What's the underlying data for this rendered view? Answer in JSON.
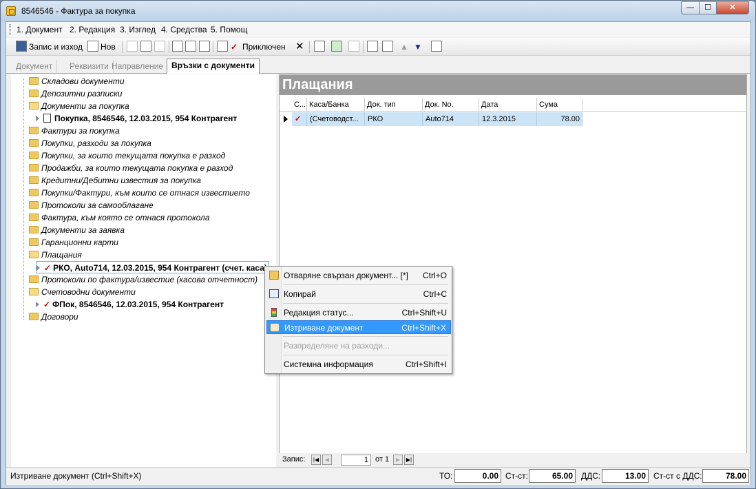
{
  "window": {
    "title": "8546546 - Фактура за покупка",
    "close_label": "✕",
    "min_label": "—",
    "max_label": "☐"
  },
  "menu": [
    "1. Документ",
    "2. Редакция",
    "3. Изглед",
    "4. Средства",
    "5. Помощ"
  ],
  "toolbar": {
    "save_exit": "Запис и изход",
    "new": "Нов",
    "posted": "Приключен"
  },
  "tabs": [
    "Документ",
    "Реквизити",
    "Направление",
    "Връзки с документи"
  ],
  "tree": [
    {
      "label": "Складови документи"
    },
    {
      "label": "Депозитни разписки"
    },
    {
      "label": "Документи за покупка"
    },
    {
      "label": "Покупка, 8546546, 12.03.2015, 954 Контрагент"
    },
    {
      "label": "Фактури за покупка"
    },
    {
      "label": "Покупки, разходи за покупка"
    },
    {
      "label": "Покупки, за които текущата покупка е разход"
    },
    {
      "label": "Продажби, за които текущата покупка е разход"
    },
    {
      "label": "Кредитни/Дебитни известия за покупка"
    },
    {
      "label": "Покупки/Фактури, към които се отнася известието"
    },
    {
      "label": "Протоколи за самооблагане"
    },
    {
      "label": "Фактура, към която се отнася протокола"
    },
    {
      "label": "Документи за заявка"
    },
    {
      "label": "Гаранционни карти"
    },
    {
      "label": "Плащания"
    },
    {
      "label": "РКО, Auto714, 12.03.2015, 954 Контрагент (счет. каса)"
    },
    {
      "label": "Протоколи по фактура/известие (касова отчетност)"
    },
    {
      "label": "Счетоводни документи"
    },
    {
      "label": "ФПок, 8546546, 12.03.2015, 954 Контрагент"
    },
    {
      "label": "Договори"
    }
  ],
  "pane": {
    "title": "Плащания"
  },
  "grid": {
    "columns": [
      "С...",
      "Каса/Банка",
      "Док. тип",
      "Док. No.",
      "Дата",
      "Сума"
    ],
    "rows": [
      {
        "status": "✓",
        "cash": "(Счетоводст...",
        "type": "РКО",
        "no": "Auto714",
        "date": "12.3.2015",
        "sum": "78.00"
      }
    ]
  },
  "pager": {
    "label": "Запис:",
    "value": "1",
    "of": "от 1"
  },
  "context_menu": [
    {
      "label": "Отваряне свързан документ... [*]",
      "shortcut": "Ctrl+O"
    },
    {
      "label": "Копирай",
      "shortcut": "Ctrl+C"
    },
    {
      "label": "Редакция статус...",
      "shortcut": "Ctrl+Shift+U"
    },
    {
      "label": "Изтриване документ",
      "shortcut": "Ctrl+Shift+X"
    },
    {
      "label": "Разпределяне на разходи...",
      "shortcut": ""
    },
    {
      "label": "Системна информация",
      "shortcut": "Ctrl+Shift+I"
    }
  ],
  "status": {
    "text": "Изтриване документ (Ctrl+Shift+X)",
    "to_label": "ТО:",
    "to_value": "0.00",
    "st_label": "Ст-ст:",
    "st_value": "65.00",
    "vat_label": "ДДС:",
    "vat_value": "13.00",
    "total_label": "Ст-ст с ДДС:",
    "total_value": "78.00"
  },
  "colors": {
    "highlight": "#3399ff",
    "row_selected": "#cde4f7",
    "pane_header": "#9a9a9a"
  }
}
